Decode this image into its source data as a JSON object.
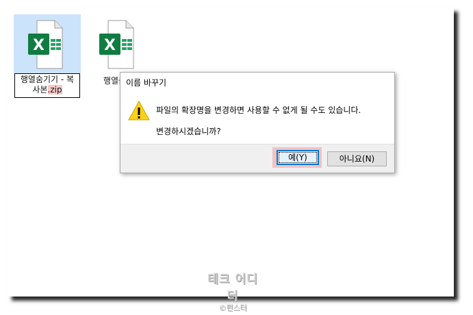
{
  "files": [
    {
      "name_main": "행열숨기기 - 복",
      "name_second_plain": "사본",
      "name_second_hl": ".zip"
    },
    {
      "name_main": "행열숨기"
    }
  ],
  "dialog": {
    "title": "이름 바꾸기",
    "message_line1": "파일의 확장명을 변경하면 사용할 수 없게 될 수도 있습니다.",
    "message_line2": "변경하시겠습니까?",
    "yes_label": "예(Y)",
    "no_label": "아니요(N)"
  },
  "watermark": {
    "line1": "테크 어디터",
    "line2": "©펀스터"
  },
  "colors": {
    "excel_green": "#107c41",
    "selection": "#cce4fb",
    "highlight": "#f6c9c9",
    "focus_border": "#0078d7"
  },
  "icons": {
    "file": "excel-file-icon",
    "dialog": "warning-icon"
  }
}
